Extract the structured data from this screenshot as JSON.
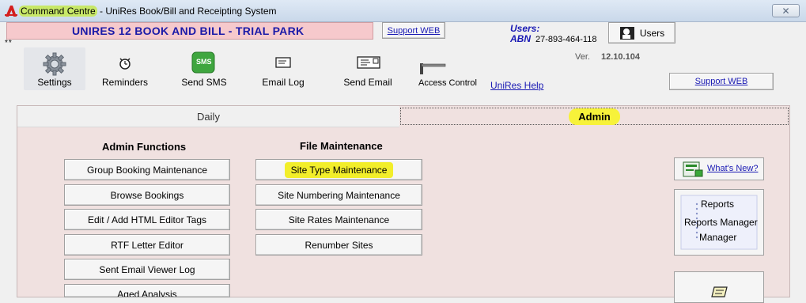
{
  "window": {
    "title_app": "Command Centre",
    "title_rest": " - UniRes Book/Bill and Receipting System",
    "close_symbol": "✕"
  },
  "header": {
    "banner": "UNIRES 12  BOOK AND BILL - TRIAL PARK",
    "support_web": "Support WEB",
    "stars": "**",
    "users_label": "Users:",
    "abn_label": "ABN",
    "abn_value": "27-893-464-118",
    "users_button": "Users",
    "ver_label": "Ver.",
    "ver_value": "12.10.104",
    "support_web_2": "Support WEB"
  },
  "toolbar": {
    "items": [
      {
        "label": "Settings",
        "icon": "gear-icon"
      },
      {
        "label": "Reminders",
        "icon": "alarm-clock-icon"
      },
      {
        "label": "Send SMS",
        "icon": "sms-icon",
        "icon_text": "SMS"
      },
      {
        "label": "Email Log",
        "icon": "envelope-icon"
      },
      {
        "label": "Send Email",
        "icon": "send-email-icon"
      },
      {
        "label": "Access Control",
        "icon": "boom-gate-icon"
      }
    ],
    "help_link": "UniRes Help"
  },
  "tabs": [
    {
      "label": "Daily",
      "active": false
    },
    {
      "label": "Admin",
      "active": true
    }
  ],
  "admin_functions": {
    "title": "Admin Functions",
    "buttons": [
      "Group Booking Maintenance",
      "Browse Bookings",
      "Edit / Add HTML Editor Tags",
      "RTF Letter Editor",
      "Sent Email Viewer Log",
      "Aged Analysis"
    ]
  },
  "file_maintenance": {
    "title": "File Maintenance",
    "buttons": [
      "Site Type Maintenance",
      "Site Numbering Maintenance",
      "Site Rates Maintenance",
      "Renumber Sites"
    ]
  },
  "side": {
    "whats_new": "What's New?",
    "reports_line1": "Reports",
    "reports_line2": "Reports Manager",
    "reports_line3": "Manager"
  },
  "colors": {
    "banner_bg": "#f6c9cc",
    "banner_text": "#1a1aa8",
    "highlight": "#f2ee2a",
    "panel_bg": "#f0e1e0",
    "link": "#1a1ab4"
  }
}
